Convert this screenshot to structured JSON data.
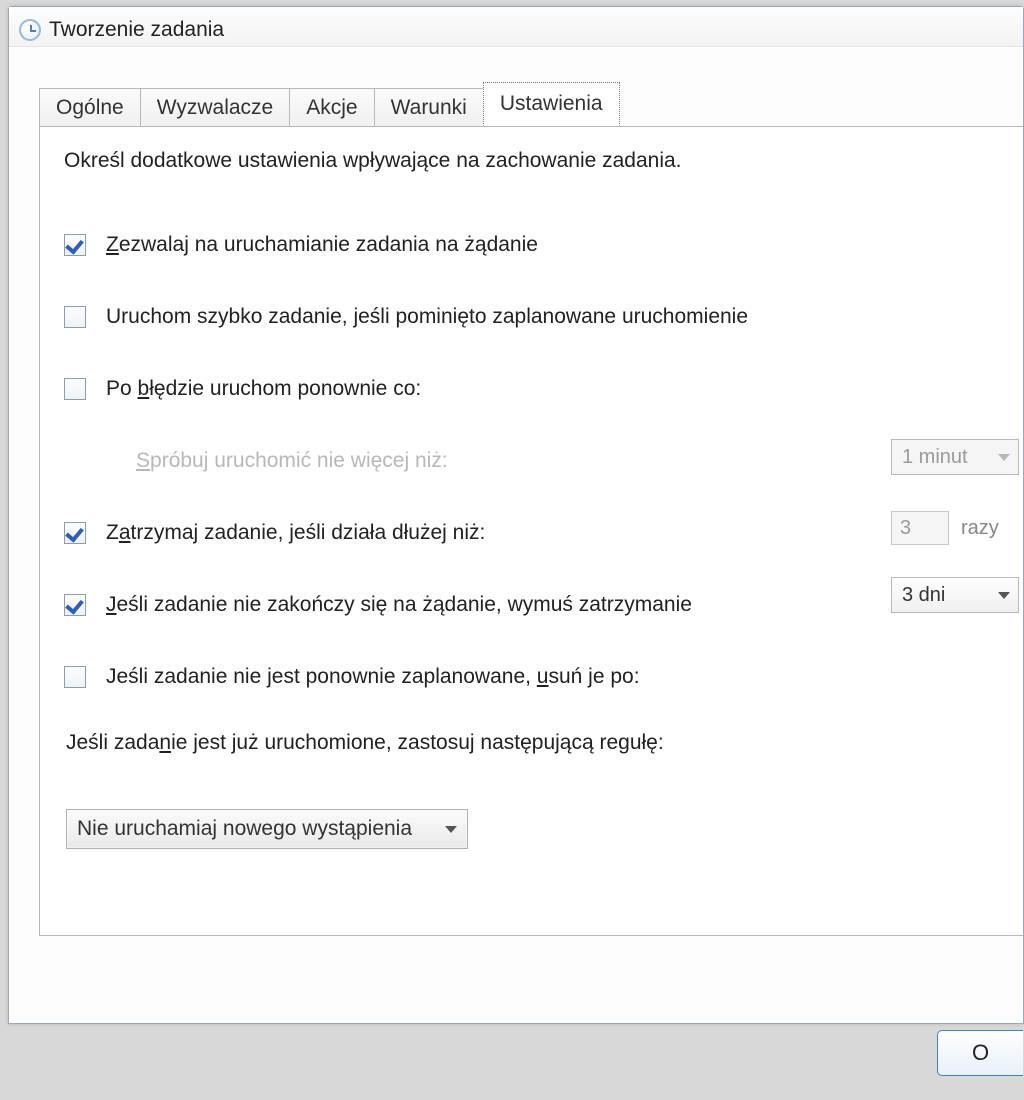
{
  "window": {
    "title": "Tworzenie zadania"
  },
  "tabs": [
    {
      "label": "Ogólne"
    },
    {
      "label": "Wyzwalacze"
    },
    {
      "label": "Akcje"
    },
    {
      "label": "Warunki"
    },
    {
      "label": "Ustawienia"
    }
  ],
  "intro": "Określ dodatkowe ustawienia wpływające na zachowanie zadania.",
  "settings": {
    "allow_on_demand": {
      "label": "Zezwalaj na uruchamianie zadania na żądanie",
      "checked": true
    },
    "run_if_missed": {
      "label": "Uruchom szybko zadanie, jeśli pominięto zaplanowane uruchomienie",
      "checked": false
    },
    "restart_on_fail": {
      "label": "Po błędzie uruchom ponownie co:",
      "checked": false,
      "interval": "1 minut"
    },
    "restart_attempts": {
      "label": "Spróbuj uruchomić nie więcej niż:",
      "value": "3",
      "unit": "razy"
    },
    "stop_if_longer": {
      "label": "Zatrzymaj zadanie, jeśli działa dłużej niż:",
      "checked": true,
      "value": "3 dni"
    },
    "force_stop": {
      "label": "Jeśli zadanie nie zakończy się na żądanie, wymuś zatrzymanie",
      "checked": true
    },
    "delete_if_not_resched": {
      "label": "Jeśli zadanie nie jest ponownie zaplanowane, usuń je po:",
      "checked": false
    }
  },
  "rule_label": "Jeśli zadanie jest już uruchomione, zastosuj następującą regułę:",
  "rule_value": "Nie uruchamiaj nowego wystąpienia",
  "buttons": {
    "ok": "O"
  }
}
